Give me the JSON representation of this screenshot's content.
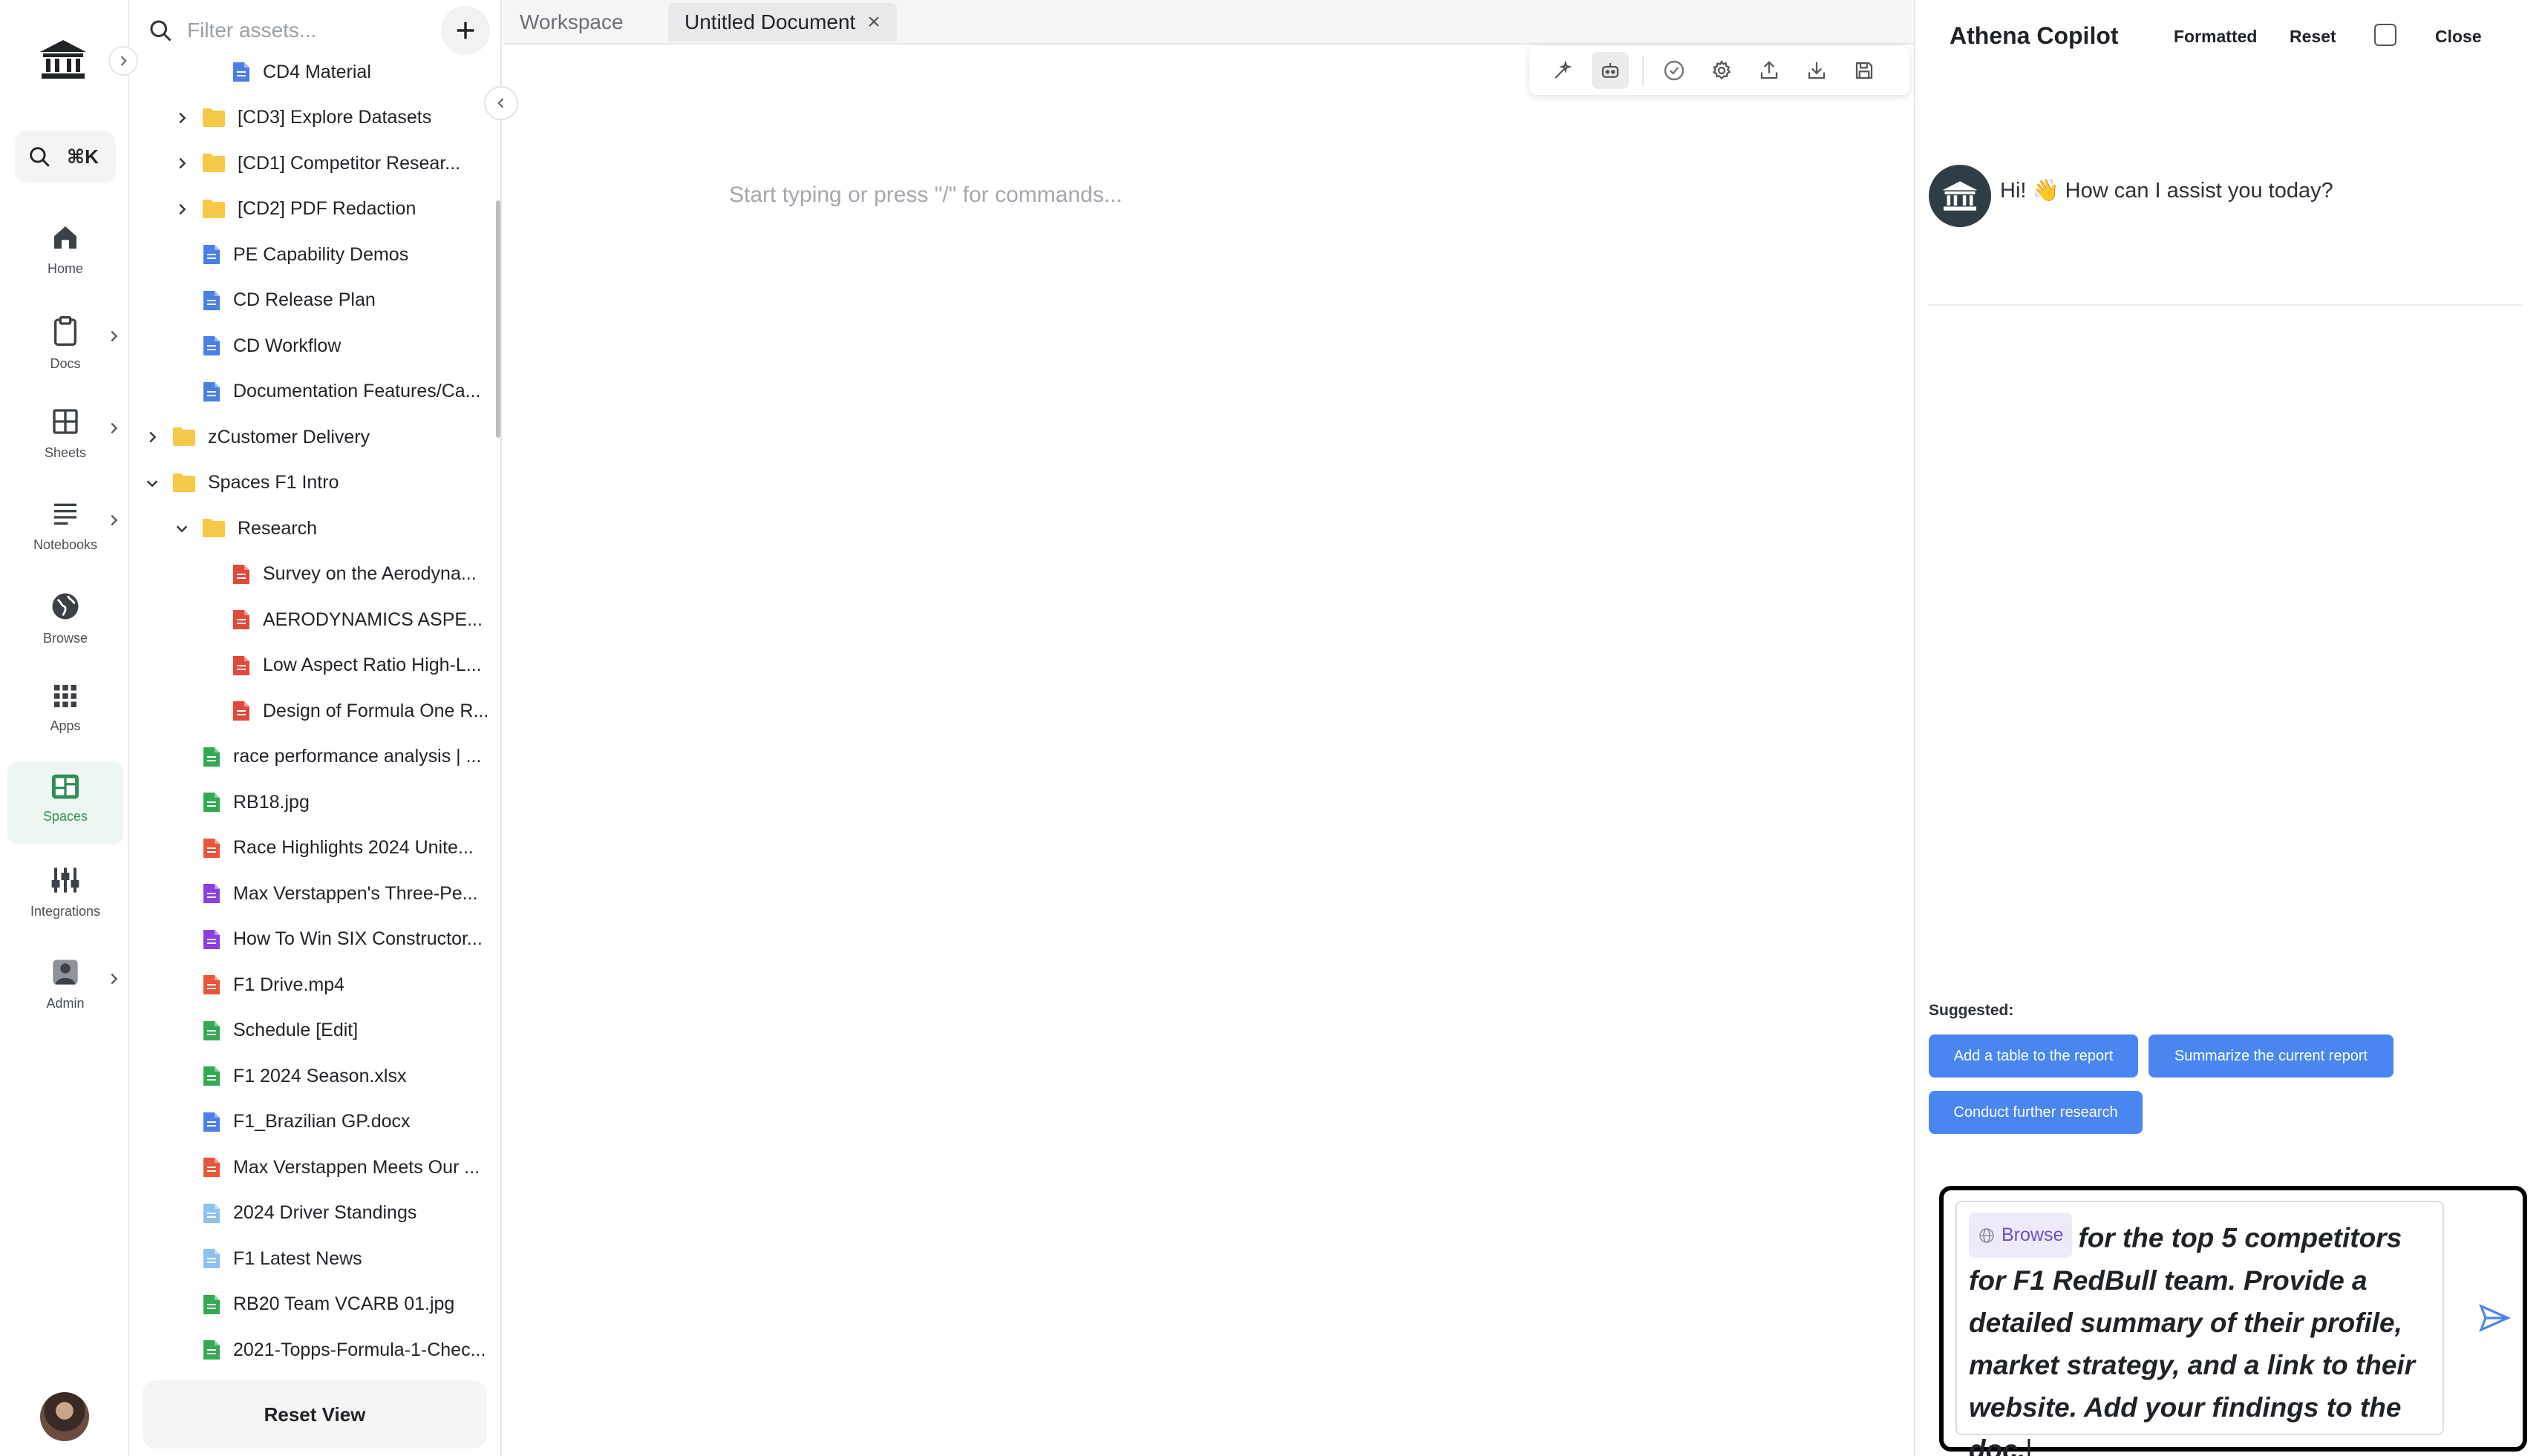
{
  "rail": {
    "search_shortcut": "⌘K",
    "items": [
      {
        "id": "home",
        "label": "Home",
        "icon": "home-icon"
      },
      {
        "id": "docs",
        "label": "Docs",
        "icon": "clipboard-icon"
      },
      {
        "id": "sheets",
        "label": "Sheets",
        "icon": "grid-icon"
      },
      {
        "id": "notebooks",
        "label": "Notebooks",
        "icon": "lines-icon"
      },
      {
        "id": "browse",
        "label": "Browse",
        "icon": "globe-icon"
      },
      {
        "id": "apps",
        "label": "Apps",
        "icon": "apps-icon"
      },
      {
        "id": "spaces",
        "label": "Spaces",
        "icon": "spaces-icon"
      },
      {
        "id": "integrations",
        "label": "Integrations",
        "icon": "sliders-icon"
      },
      {
        "id": "admin",
        "label": "Admin",
        "icon": "user-icon"
      }
    ],
    "active": "spaces"
  },
  "assets": {
    "filter_placeholder": "Filter assets...",
    "reset_view": "Reset View",
    "tree": [
      {
        "label": "CD4 Material",
        "type": "doc",
        "depth": 2
      },
      {
        "label": "[CD3] Explore Datasets",
        "type": "folder",
        "depth": 1,
        "state": "collapsed"
      },
      {
        "label": "[CD1] Competitor Resear...",
        "type": "folder",
        "depth": 1,
        "state": "collapsed"
      },
      {
        "label": "[CD2] PDF Redaction",
        "type": "folder",
        "depth": 1,
        "state": "collapsed"
      },
      {
        "label": "PE Capability Demos",
        "type": "doc",
        "depth": 1
      },
      {
        "label": "CD Release Plan",
        "type": "doc",
        "depth": 1
      },
      {
        "label": "CD Workflow",
        "type": "doc",
        "depth": 1
      },
      {
        "label": "Documentation Features/Ca...",
        "type": "doc",
        "depth": 1
      },
      {
        "label": "zCustomer Delivery",
        "type": "folder",
        "depth": 0,
        "state": "collapsed"
      },
      {
        "label": "Spaces F1 Intro",
        "type": "folder",
        "depth": 0,
        "state": "expanded"
      },
      {
        "label": "Research",
        "type": "folder",
        "depth": 1,
        "state": "expanded"
      },
      {
        "label": "Survey on the Aerodyna...",
        "type": "pdf",
        "depth": 2
      },
      {
        "label": "AERODYNAMICS ASPE...",
        "type": "pdf",
        "depth": 2
      },
      {
        "label": "Low Aspect Ratio High-L...",
        "type": "pdf",
        "depth": 2
      },
      {
        "label": "Design of Formula One R...",
        "type": "pdf",
        "depth": 2
      },
      {
        "label": "race performance analysis | ...",
        "type": "sheet",
        "depth": 1
      },
      {
        "label": "RB18.jpg",
        "type": "image",
        "depth": 1
      },
      {
        "label": "Race Highlights 2024 Unite...",
        "type": "video",
        "depth": 1
      },
      {
        "label": "Max Verstappen's Three-Pe...",
        "type": "audio",
        "depth": 1
      },
      {
        "label": "How To Win SIX Constructor...",
        "type": "audio",
        "depth": 1
      },
      {
        "label": "F1 Drive.mp4",
        "type": "video",
        "depth": 1
      },
      {
        "label": "Schedule [Edit]",
        "type": "sheet",
        "depth": 1
      },
      {
        "label": "F1 2024 Season.xlsx",
        "type": "sheet",
        "depth": 1
      },
      {
        "label": "F1_Brazilian GP.docx",
        "type": "doc",
        "depth": 1
      },
      {
        "label": "Max Verstappen Meets Our ...",
        "type": "video",
        "depth": 1
      },
      {
        "label": "2024 Driver Standings",
        "type": "note",
        "depth": 1
      },
      {
        "label": "F1 Latest News",
        "type": "note",
        "depth": 1
      },
      {
        "label": "RB20 Team VCARB 01.jpg",
        "type": "image",
        "depth": 1
      },
      {
        "label": "2021-Topps-Formula-1-Chec...",
        "type": "sheet",
        "depth": 1
      }
    ]
  },
  "document": {
    "tabs": [
      {
        "label": "Workspace",
        "active": false
      },
      {
        "label": "Untitled Document",
        "active": true,
        "close": "×"
      }
    ],
    "placeholder": "Start typing or press \"/\" for commands...",
    "toolbar": [
      "magic-wand-icon",
      "robot-icon",
      "check-circle-icon",
      "gear-icon",
      "upload-icon",
      "download-icon",
      "save-icon"
    ]
  },
  "copilot": {
    "title": "Athena Copilot",
    "actions": {
      "formatted": "Formatted",
      "reset": "Reset",
      "close": "Close"
    },
    "greeting": "Hi! 👋 How can I assist you today?",
    "suggested_label": "Suggested:",
    "suggestions": [
      "Add a table to the report",
      "Summarize the current report",
      "Conduct further research"
    ],
    "input": {
      "chip": "Browse",
      "text": "for the top 5 competitors for F1 RedBull team. Provide a detailed summary of their profile, market strategy, and a link to their website. Add your findings to the doc."
    }
  },
  "colors": {
    "accent_blue": "#4a86f0",
    "active_green": "#2f8f57",
    "folder_yellow": "#f7c948",
    "doc_blue": "#4a7fe5",
    "pdf_red": "#e04a3b",
    "sheet_green": "#34a853",
    "audio_purple": "#8b3fe0",
    "video_orange": "#e8553a",
    "note_lightblue": "#8ec1f0"
  }
}
